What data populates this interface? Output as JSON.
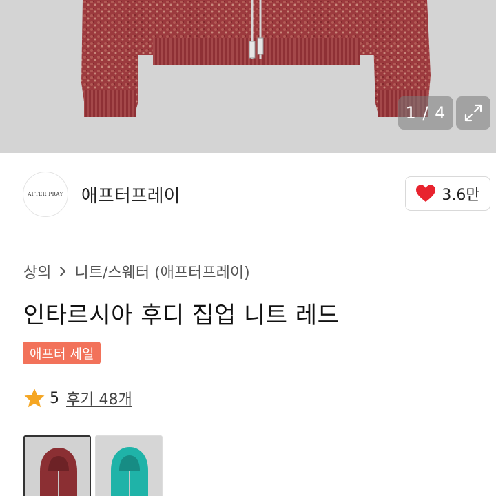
{
  "gallery": {
    "counter": "1 / 4",
    "expand_icon": "expand-arrows-icon"
  },
  "brand": {
    "logo_text": "AFTER PRAY",
    "name": "애프터프레이",
    "like_count": "3.6만",
    "like_icon": "heart-icon",
    "like_color": "#e8232e"
  },
  "breadcrumb": {
    "items": [
      "상의",
      "니트/스웨터 (애프터프레이)"
    ],
    "separator_icon": "chevron-right-icon"
  },
  "product": {
    "title": "인타르시아 후디 집업 니트 레드",
    "badge": "애프터 세일",
    "badge_color": "#f2725a",
    "rating": "5",
    "reviews": "후기 48개",
    "star_color": "#f5a623"
  },
  "options": {
    "swatches": [
      {
        "color": "red",
        "hex": "#8b2f33",
        "selected": true
      },
      {
        "color": "teal",
        "hex": "#1fb3a8",
        "selected": false
      }
    ]
  }
}
